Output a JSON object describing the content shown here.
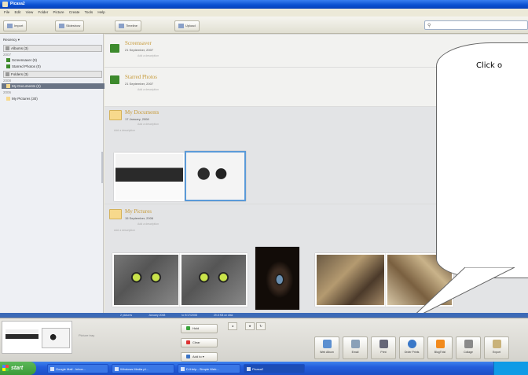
{
  "window": {
    "title": "Picasa2"
  },
  "menu": [
    "File",
    "Edit",
    "View",
    "Folder",
    "Picture",
    "Create",
    "Tools",
    "Help"
  ],
  "toolbar": {
    "buttons": [
      "Import",
      "Slideshow",
      "Timeline",
      "Upload"
    ],
    "search_placeholder": ""
  },
  "sidebar": {
    "sort": "Recency",
    "items": [
      {
        "label": "Albums (3)",
        "type": "head"
      },
      {
        "label": "2007",
        "type": "year"
      },
      {
        "label": "Screensaver (0)",
        "type": "album"
      },
      {
        "label": "Starred Photos (0)",
        "type": "album"
      },
      {
        "label": "Folders (3)",
        "type": "head"
      },
      {
        "label": "2008",
        "type": "year"
      },
      {
        "label": "My Documents (2)",
        "type": "folder",
        "selected": true
      },
      {
        "label": "2006",
        "type": "year"
      },
      {
        "label": "My Pictures (30)",
        "type": "folder"
      }
    ]
  },
  "albums": [
    {
      "title": "Screensaver",
      "date": "21 September, 2007",
      "sub": "Add a description"
    },
    {
      "title": "Starred Photos",
      "date": "21 September, 2007",
      "sub": "Add a description"
    },
    {
      "title": "My Documents",
      "date": "17 January, 2008",
      "sub": "Add a description",
      "note": "Add a description"
    },
    {
      "title": "My Pictures",
      "date": "15 September, 2006",
      "sub": "Add a description",
      "note": "Add a description"
    }
  ],
  "callout": {
    "text": "Click o"
  },
  "statusbar": {
    "items": [
      "2 pictures",
      "January 2008",
      "to 9/17/2008",
      "29.8 KB on disk"
    ]
  },
  "tray": {
    "label": "Picture tray",
    "side_buttons": [
      "Hold",
      "Clear",
      "Add to"
    ],
    "actions": [
      "Web Album",
      "Email",
      "Print",
      "Order Prints",
      "BlogThis!",
      "Collage",
      "Export"
    ]
  },
  "taskbar": {
    "start": "start",
    "tasks": [
      "Google Mail - Inbox...",
      "Windows Media pl...",
      "D:\\Help - Simple Web...",
      "Picasa2"
    ]
  }
}
